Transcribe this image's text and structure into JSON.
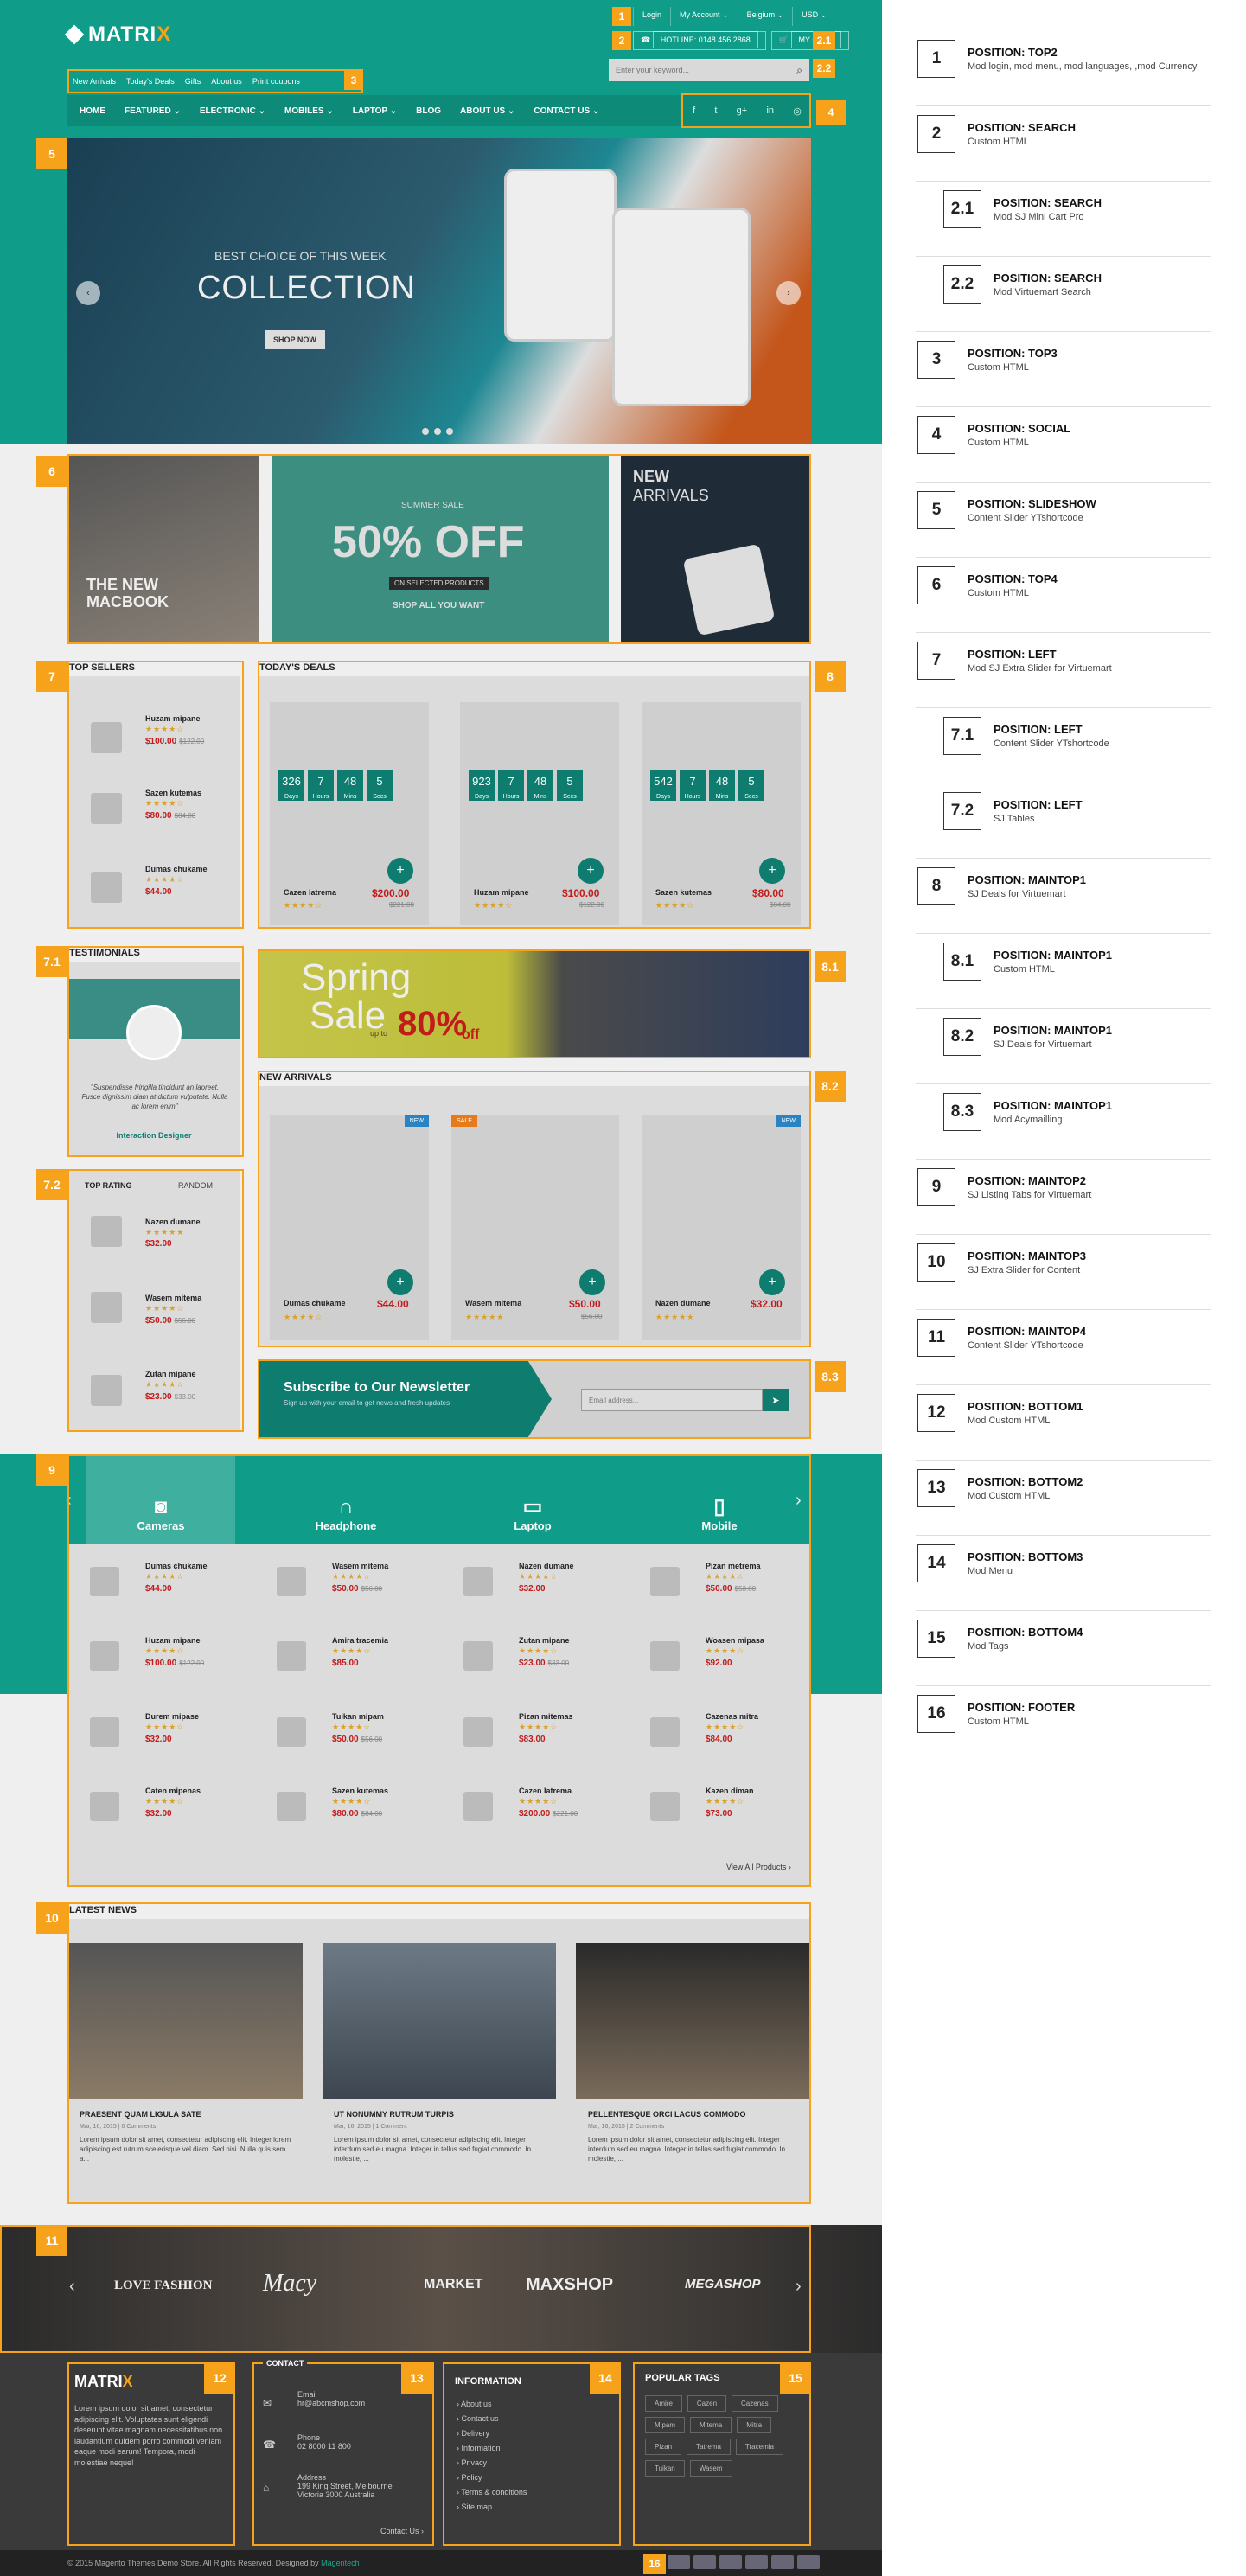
{
  "brand": {
    "name_a": "MATRI",
    "name_b": "X"
  },
  "top_links": [
    "Login",
    "My Account ⌄",
    "Belgium ⌄",
    "USD ⌄"
  ],
  "hotline": "HOTLINE: 0148 456 2868",
  "cart": "MY CART",
  "search_placeholder": "Enter your keyword...",
  "top3": [
    "New Arrivals",
    "Today's Deals",
    "Gifts",
    "About us",
    "Print coupons"
  ],
  "nav": [
    "HOME",
    "FEATURED ⌄",
    "ELECTRONIC ⌄",
    "MOBILES ⌄",
    "LAPTOP ⌄",
    "BLOG",
    "ABOUT US ⌄",
    "CONTACT US ⌄"
  ],
  "social": [
    "f",
    "t",
    "g+",
    "in",
    "◎"
  ],
  "slide": {
    "sub": "BEST CHOICE OF THIS WEEK",
    "title": "COLLECTION",
    "btn": "SHOP NOW"
  },
  "banners": {
    "b1": "THE NEW MACBOOK",
    "b2_small": "SUMMER SALE",
    "b2_big": "50% OFF",
    "b2_tag": "ON SELECTED PRODUCTS",
    "b2_shop": "SHOP ALL YOU WANT",
    "b3a": "NEW",
    "b3b": "ARRIVALS"
  },
  "top_sellers": {
    "title": "TOP SELLERS",
    "items": [
      {
        "name": "Huzam mipane",
        "stars": "★★★★☆",
        "price": "$100.00",
        "old": "$122.00"
      },
      {
        "name": "Sazen kutemas",
        "stars": "★★★★☆",
        "price": "$80.00",
        "old": "$84.00"
      },
      {
        "name": "Dumas chukame",
        "stars": "★★★★☆",
        "price": "$44.00",
        "old": ""
      }
    ]
  },
  "deals": {
    "title": "TODAY'S DEALS",
    "items": [
      {
        "name": "Cazen latrema",
        "price": "$200.00",
        "old": "$221.00",
        "cnt": [
          "326",
          "7",
          "48",
          "5"
        ]
      },
      {
        "name": "Huzam mipane",
        "price": "$100.00",
        "old": "$122.00",
        "cnt": [
          "923",
          "7",
          "48",
          "5"
        ]
      },
      {
        "name": "Sazen kutemas",
        "price": "$80.00",
        "old": "$84.00",
        "cnt": [
          "542",
          "7",
          "48",
          "5"
        ]
      }
    ],
    "cnt_labels": [
      "Days",
      "Hours",
      "Mins",
      "Secs"
    ]
  },
  "testimonial": {
    "title": "TESTIMONIALS",
    "quote": "\"Suspendisse fringilla tincidunt an laoreet. Fusce dignissim diam at dictum vulputate. Nulla ac lorem enim\"",
    "author": "Interaction Designer"
  },
  "rating": {
    "tab1": "TOP RATING",
    "tab2": "RANDOM",
    "items": [
      {
        "name": "Nazen dumane",
        "price": "$32.00",
        "old": ""
      },
      {
        "name": "Wasem mitema",
        "price": "$50.00",
        "old": "$56.00"
      },
      {
        "name": "Zutan mipane",
        "price": "$23.00",
        "old": "$33.00"
      }
    ]
  },
  "spring": {
    "a": "Spring",
    "b": "Sale",
    "c": "up to",
    "d": "80%",
    "e": "off"
  },
  "new_arrivals": {
    "title": "NEW ARRIVALS",
    "items": [
      {
        "name": "Dumas chukame",
        "price": "$44.00",
        "old": "",
        "badge": "NEW"
      },
      {
        "name": "Wasem mitema",
        "price": "$50.00",
        "old": "$56.00",
        "badge": "SALE"
      },
      {
        "name": "Nazen dumane",
        "price": "$32.00",
        "old": "",
        "badge": "NEW"
      }
    ]
  },
  "newsletter": {
    "title": "Subscribe to Our Newsletter",
    "sub": "Sign up with your email to get news and fresh updates",
    "placeholder": "Email address..."
  },
  "tabs": [
    "Cameras",
    "Headphone",
    "Laptop",
    "Mobile"
  ],
  "listing": [
    {
      "name": "Dumas chukame",
      "price": "$44.00",
      "old": ""
    },
    {
      "name": "Wasem mitema",
      "price": "$50.00",
      "old": "$56.00"
    },
    {
      "name": "Nazen dumane",
      "price": "$32.00",
      "old": ""
    },
    {
      "name": "Pizan metrema",
      "price": "$50.00",
      "old": "$53.00"
    },
    {
      "name": "Huzam mipane",
      "price": "$100.00",
      "old": "$122.00"
    },
    {
      "name": "Amira tracemia",
      "price": "$85.00",
      "old": ""
    },
    {
      "name": "Zutan mipane",
      "price": "$23.00",
      "old": "$33.00"
    },
    {
      "name": "Woasen mipasa",
      "price": "$92.00",
      "old": ""
    },
    {
      "name": "Durem mipase",
      "price": "$32.00",
      "old": ""
    },
    {
      "name": "Tuikan mipam",
      "price": "$50.00",
      "old": "$56.00"
    },
    {
      "name": "Pizan mitemas",
      "price": "$83.00",
      "old": ""
    },
    {
      "name": "Cazenas mitra",
      "price": "$84.00",
      "old": ""
    },
    {
      "name": "Caten mipenas",
      "price": "$32.00",
      "old": ""
    },
    {
      "name": "Sazen kutemas",
      "price": "$80.00",
      "old": "$84.00"
    },
    {
      "name": "Cazen latrema",
      "price": "$200.00",
      "old": "$221.00"
    },
    {
      "name": "Kazen diman",
      "price": "$73.00",
      "old": ""
    }
  ],
  "view_all": "View All Products ›",
  "news": {
    "title": "LATEST NEWS",
    "items": [
      {
        "title": "PRAESENT QUAM LIGULA SATE",
        "meta": "Mar, 16, 2015 | 0 Comments",
        "body": "Lorem ipsum dolor sit amet, consectetur adipiscing elit. Integer lorem adipiscing est rutrum scelerisque vel diam. Sed nisi. Nulla quis sem a..."
      },
      {
        "title": "UT NONUMMY RUTRUM TURPIS",
        "meta": "Mar, 16, 2015 | 1 Comment",
        "body": "Lorem ipsum dolor sit amet, consectetur adipiscing elit. Integer interdum sed eu magna. Integer in tellus sed fugiat commodo. In molestie, ..."
      },
      {
        "title": "PELLENTESQUE ORCI LACUS COMMODO",
        "meta": "Mar, 16, 2015 | 2 Comments",
        "body": "Lorem ipsum dolor sit amet, consectetur adipiscing elit. Integer interdum sed eu magna. Integer in tellus sed fugiat commodo. In molestie, ..."
      }
    ]
  },
  "brands": [
    "LOVE FASHION",
    "Macy",
    "MARKET",
    "MAXSHOP",
    "MEGASHOP"
  ],
  "footer": {
    "about": "Lorem ipsum dolor sit amet, consectetur adipiscing elit. Voluptates sunt eligendi deserunt vitae magnam necessitatibus non laudantium quidem porro commodi veniam eaque modi earum! Tempora, modi molestiae neque!",
    "contact_title": "CONTACT",
    "email_label": "Email",
    "email": "hr@abcmshop.com",
    "phone_label": "Phone",
    "phone": "02 8000 11 800",
    "addr_label": "Address",
    "addr": "199 King Street, Melbourne Victoria 3000 Australia",
    "contact_link": "Contact Us ›",
    "info_title": "INFORMATION",
    "info": [
      "About us",
      "Contact us",
      "Delivery",
      "Information",
      "Privacy",
      "Policy",
      "Terms & conditions",
      "Site map"
    ],
    "tags_title": "POPULAR TAGS",
    "tags": [
      "Amire",
      "Cazen",
      "Cazenas",
      "Mipam",
      "Mitema",
      "Mitra",
      "Pizan",
      "Tatrema",
      "Tracemia",
      "Tuikan",
      "Wasem"
    ]
  },
  "copyright": "© 2015 Magento Themes Demo Store. All Rights Reserved. Designed by",
  "copyright_link": "Magentech",
  "positions": [
    {
      "n": "1",
      "t": "POSITION: TOP2",
      "d": "Mod login, mod menu, mod languages, ,mod Currency"
    },
    {
      "n": "2",
      "t": "POSITION: SEARCH",
      "d": "Custom HTML"
    },
    {
      "n": "2.1",
      "t": "POSITION: SEARCH",
      "d": "Mod SJ Mini Cart Pro"
    },
    {
      "n": "2.2",
      "t": "POSITION: SEARCH",
      "d": "Mod Virtuemart Search"
    },
    {
      "n": "3",
      "t": "POSITION: TOP3",
      "d": "Custom HTML"
    },
    {
      "n": "4",
      "t": "POSITION: SOCIAL",
      "d": "Custom HTML"
    },
    {
      "n": "5",
      "t": "POSITION: SLIDESHOW",
      "d": "Content Slider YTshortcode"
    },
    {
      "n": "6",
      "t": "POSITION: TOP4",
      "d": "Custom HTML"
    },
    {
      "n": "7",
      "t": "POSITION: LEFT",
      "d": "Mod SJ Extra Slider for Virtuemart"
    },
    {
      "n": "7.1",
      "t": "POSITION: LEFT",
      "d": "Content Slider YTshortcode"
    },
    {
      "n": "7.2",
      "t": "POSITION: LEFT",
      "d": "SJ Tables"
    },
    {
      "n": "8",
      "t": "POSITION: MAINTOP1",
      "d": "SJ Deals for Virtuemart"
    },
    {
      "n": "8.1",
      "t": "POSITION: MAINTOP1",
      "d": "Custom HTML"
    },
    {
      "n": "8.2",
      "t": "POSITION: MAINTOP1",
      "d": "SJ Deals for Virtuemart"
    },
    {
      "n": "8.3",
      "t": "POSITION: MAINTOP1",
      "d": "Mod Acymailling"
    },
    {
      "n": "9",
      "t": "POSITION: MAINTOP2",
      "d": "SJ Listing Tabs for Virtuemart"
    },
    {
      "n": "10",
      "t": "POSITION: MAINTOP3",
      "d": "SJ Extra Slider for Content"
    },
    {
      "n": "11",
      "t": "POSITION: MAINTOP4",
      "d": "Content Slider YTshortcode"
    },
    {
      "n": "12",
      "t": "POSITION: BOTTOM1",
      "d": "Mod Custom HTML"
    },
    {
      "n": "13",
      "t": "POSITION: BOTTOM2",
      "d": "Mod Custom HTML"
    },
    {
      "n": "14",
      "t": "POSITION: BOTTOM3",
      "d": "Mod Menu"
    },
    {
      "n": "15",
      "t": "POSITION: BOTTOM4",
      "d": "Mod Tags"
    },
    {
      "n": "16",
      "t": "POSITION: FOOTER",
      "d": "Custom HTML"
    }
  ],
  "marks": [
    "1",
    "2",
    "2.1",
    "2.2",
    "3",
    "4",
    "5",
    "6",
    "7",
    "7.1",
    "7.2",
    "8",
    "8.1",
    "8.2",
    "8.3",
    "9",
    "10",
    "11",
    "12",
    "13",
    "14",
    "15",
    "16"
  ]
}
